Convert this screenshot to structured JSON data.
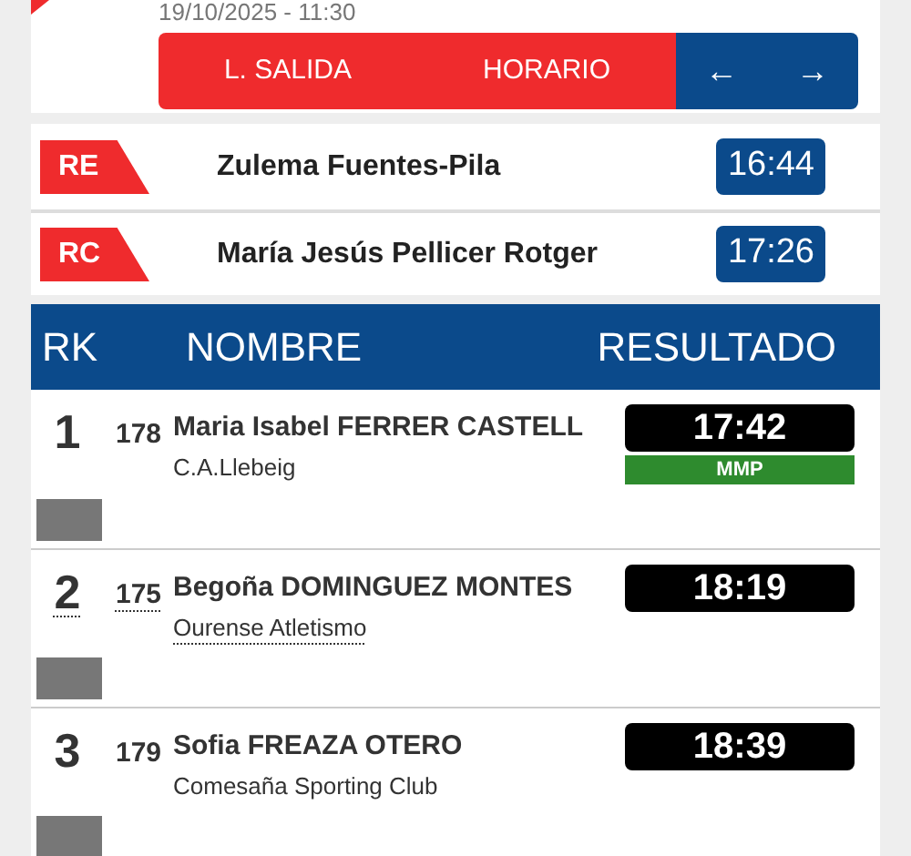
{
  "event": {
    "datetime": "19/10/2025 - 11:30"
  },
  "nav": {
    "buttons": [
      {
        "label": "L. SALIDA"
      },
      {
        "label": "HORARIO"
      }
    ],
    "arrows": [
      "←",
      "→"
    ]
  },
  "records": [
    {
      "tag": "RE",
      "name": "Zulema Fuentes-Pila",
      "time": "16:44"
    },
    {
      "tag": "RC",
      "name": "María Jesús Pellicer Rotger",
      "time": "17:26"
    }
  ],
  "table": {
    "columns": [
      "RK",
      "NOMBRE",
      "RESULTADO"
    ],
    "rows": [
      {
        "rank": "1",
        "bib": "178",
        "first": "Maria Isabel",
        "last": "FERRER CASTELL",
        "club": "C.A.Llebeig",
        "result": "17:42",
        "badge": "MMP",
        "linked": false
      },
      {
        "rank": "2",
        "bib": "175",
        "first": "Begoña",
        "last": "DOMINGUEZ MONTES",
        "club": "Ourense Atletismo",
        "result": "18:19",
        "linked": true
      },
      {
        "rank": "3",
        "bib": "179",
        "first": "Sofia",
        "last": "FREAZA OTERO",
        "club": "Comesaña Sporting Club",
        "result": "18:39",
        "linked": false
      }
    ]
  }
}
